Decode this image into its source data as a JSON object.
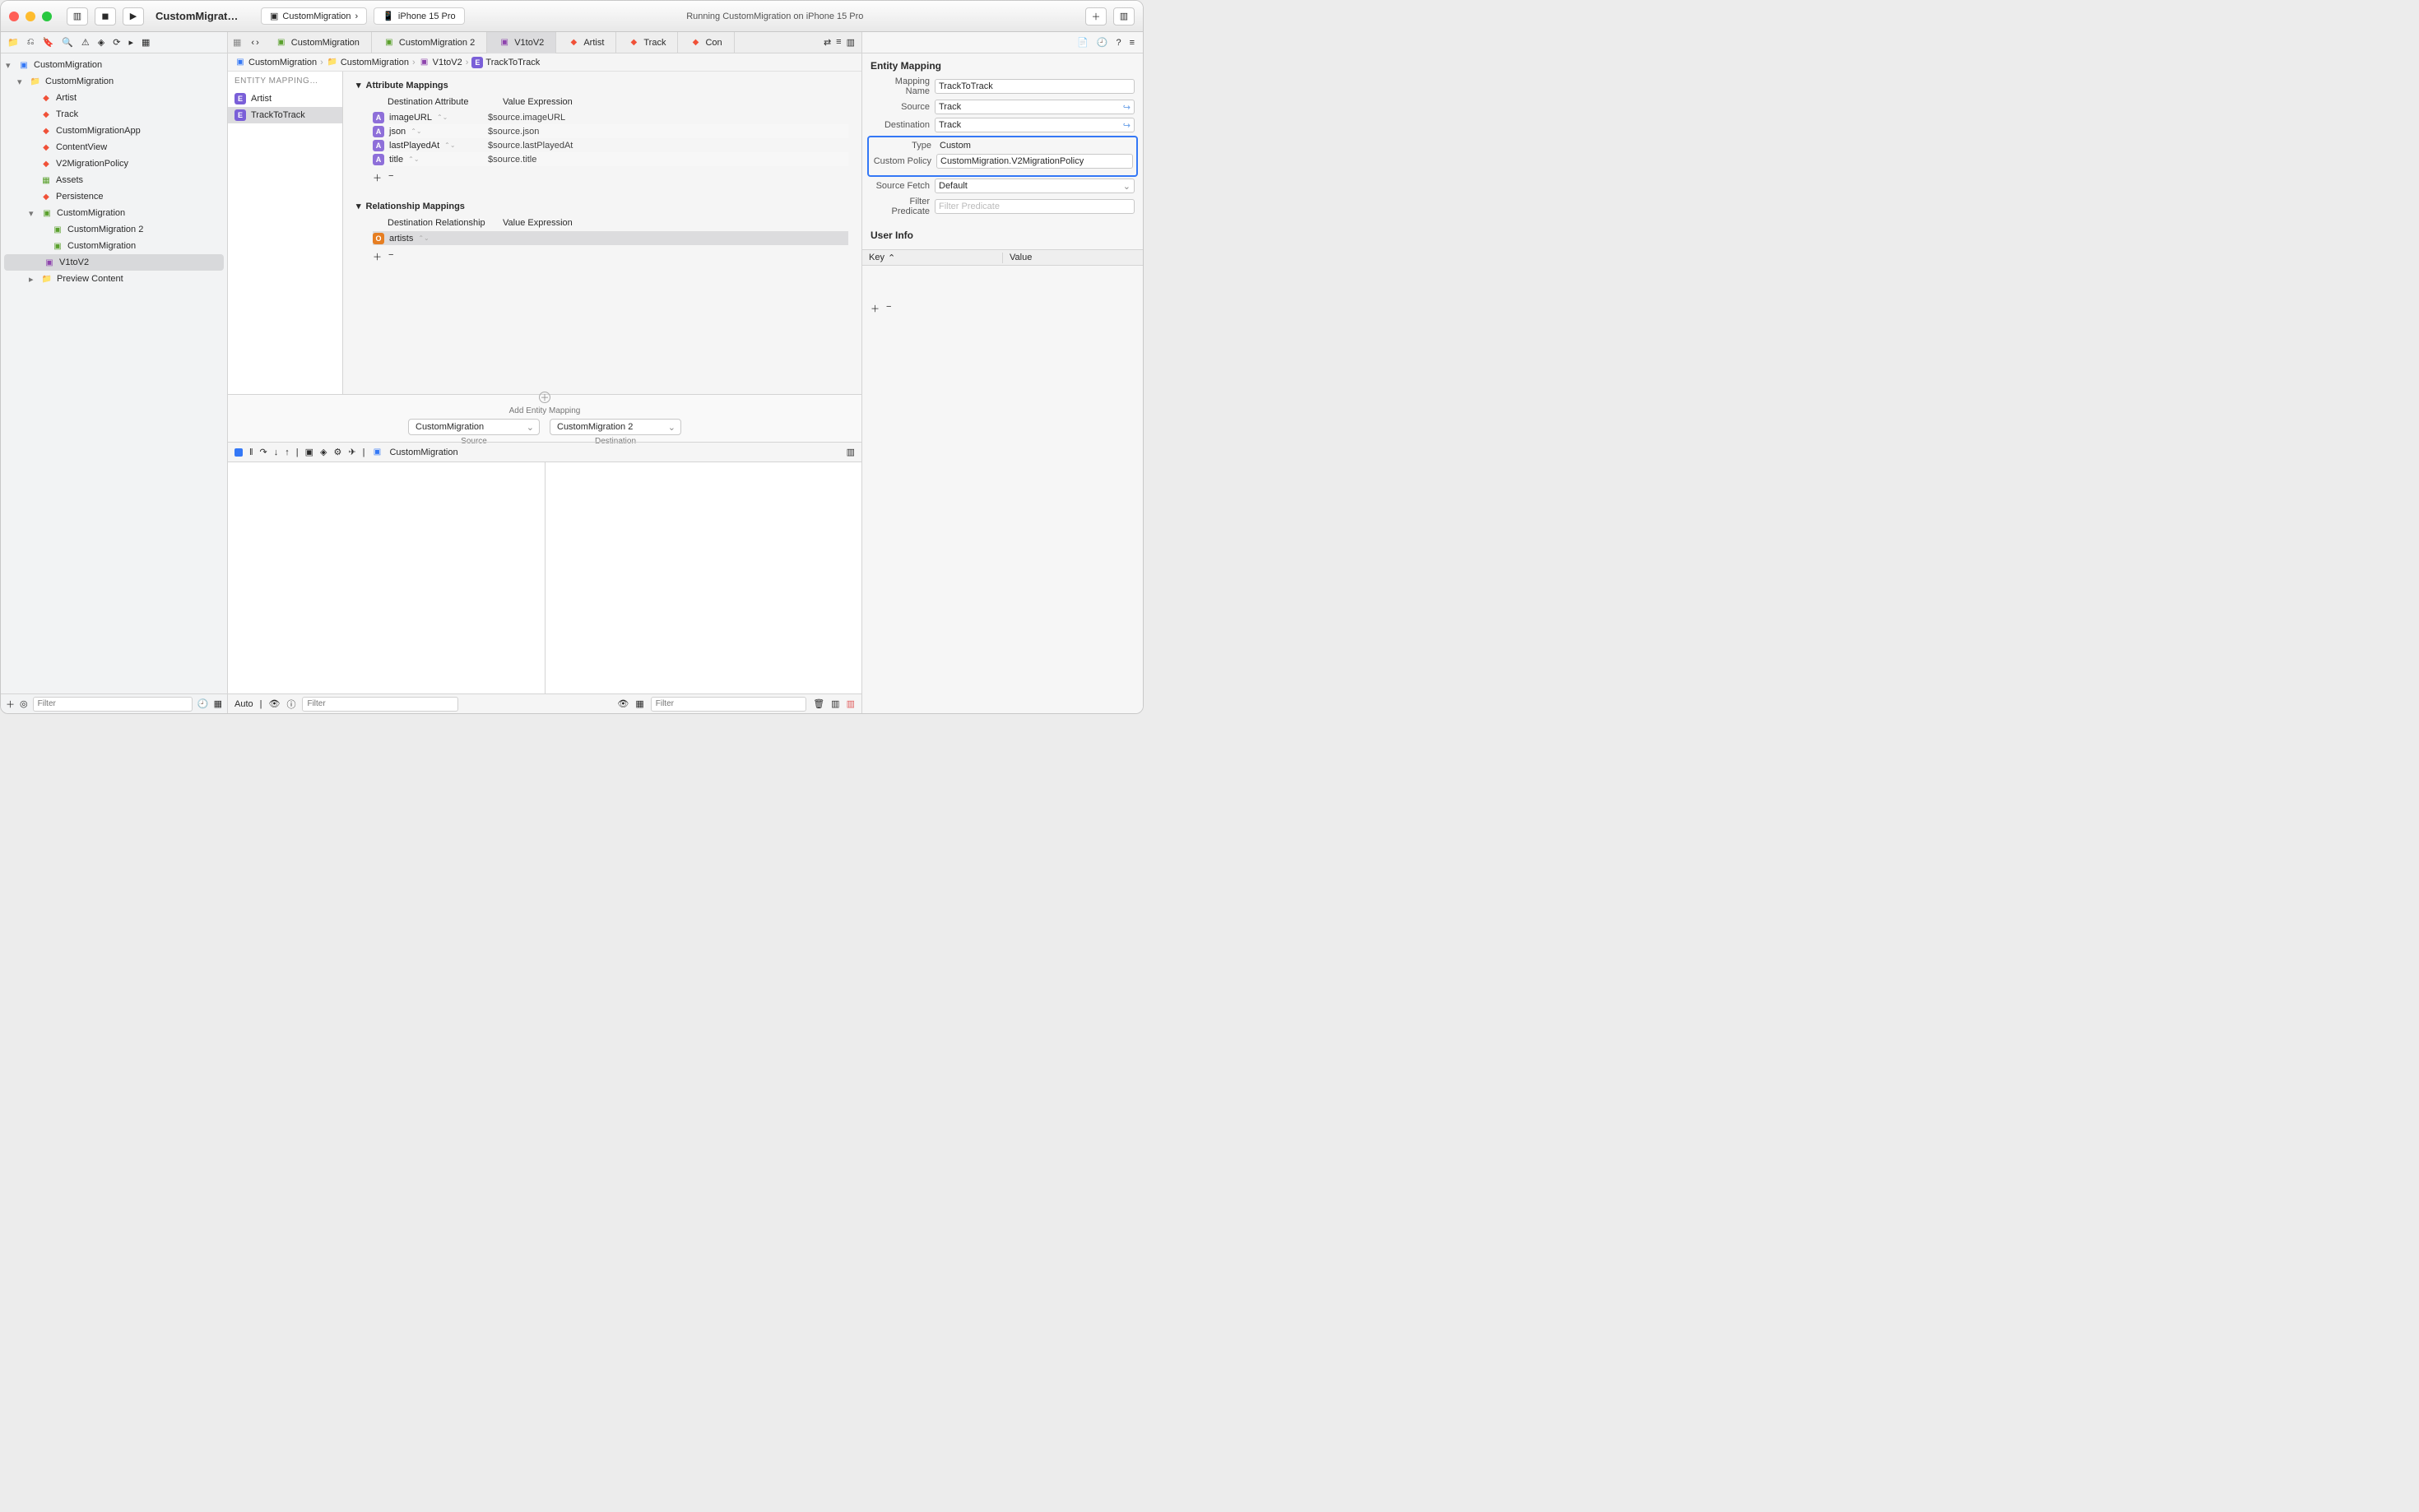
{
  "window": {
    "title": "CustomMigrat…",
    "scheme": "CustomMigration",
    "device": "iPhone 15 Pro",
    "status": "Running CustomMigration on iPhone 15 Pro"
  },
  "navigator": {
    "project": "CustomMigration",
    "groups": [
      {
        "label": "CustomMigration",
        "depth": 0,
        "icon": "app"
      },
      {
        "label": "CustomMigration",
        "depth": 1,
        "icon": "folder"
      },
      {
        "label": "Artist",
        "depth": 2,
        "icon": "swift"
      },
      {
        "label": "Track",
        "depth": 2,
        "icon": "swift"
      },
      {
        "label": "CustomMigrationApp",
        "depth": 2,
        "icon": "swift"
      },
      {
        "label": "ContentView",
        "depth": 2,
        "icon": "swift"
      },
      {
        "label": "V2MigrationPolicy",
        "depth": 2,
        "icon": "swift"
      },
      {
        "label": "Assets",
        "depth": 2,
        "icon": "assets"
      },
      {
        "label": "Persistence",
        "depth": 2,
        "icon": "swift"
      },
      {
        "label": "CustomMigration",
        "depth": 2,
        "icon": "model"
      },
      {
        "label": "CustomMigration 2",
        "depth": 3,
        "icon": "modelversion"
      },
      {
        "label": "CustomMigration",
        "depth": 3,
        "icon": "modelversion"
      },
      {
        "label": "V1toV2",
        "depth": 2,
        "icon": "mapping",
        "selected": true
      },
      {
        "label": "Preview Content",
        "depth": 2,
        "icon": "folder"
      }
    ],
    "filter_placeholder": "Filter"
  },
  "tabs": [
    {
      "label": "CustomMigration",
      "icon": "model"
    },
    {
      "label": "CustomMigration 2",
      "icon": "modelversion"
    },
    {
      "label": "V1toV2",
      "icon": "mapping",
      "active": true
    },
    {
      "label": "Artist",
      "icon": "swift"
    },
    {
      "label": "Track",
      "icon": "swift"
    },
    {
      "label": "Con",
      "icon": "swift"
    }
  ],
  "breadcrumb": [
    "CustomMigration",
    "CustomMigration",
    "V1toV2",
    "TrackToTrack"
  ],
  "entity_list": {
    "header": "ENTITY MAPPING…",
    "items": [
      {
        "label": "Artist"
      },
      {
        "label": "TrackToTrack",
        "selected": true
      }
    ]
  },
  "attribute_mappings": {
    "title": "Attribute Mappings",
    "cols": [
      "Destination Attribute",
      "Value Expression"
    ],
    "rows": [
      {
        "name": "imageURL",
        "expr": "$source.imageURL"
      },
      {
        "name": "json",
        "expr": "$source.json"
      },
      {
        "name": "lastPlayedAt",
        "expr": "$source.lastPlayedAt"
      },
      {
        "name": "title",
        "expr": "$source.title"
      }
    ]
  },
  "relationship_mappings": {
    "title": "Relationship Mappings",
    "cols": [
      "Destination Relationship",
      "Value Expression"
    ],
    "rows": [
      {
        "name": "artists",
        "expr": ""
      }
    ]
  },
  "add_entity_label": "Add Entity Mapping",
  "source_selector": {
    "source": "CustomMigration",
    "dest": "CustomMigration 2",
    "source_label": "Source",
    "dest_label": "Destination"
  },
  "debug": {
    "process": "CustomMigration",
    "auto": "Auto",
    "filter_placeholder": "Filter"
  },
  "inspector": {
    "section_title": "Entity Mapping",
    "mapping_name_label": "Mapping Name",
    "mapping_name": "TrackToTrack",
    "source_label": "Source",
    "source": "Track",
    "dest_label": "Destination",
    "dest": "Track",
    "type_label": "Type",
    "type": "Custom",
    "custom_policy_label": "Custom Policy",
    "custom_policy": "CustomMigration.V2MigrationPolicy",
    "source_fetch_label": "Source Fetch",
    "source_fetch": "Default",
    "filter_predicate_label": "Filter Predicate",
    "filter_predicate_placeholder": "Filter Predicate",
    "user_info_title": "User Info",
    "key_col": "Key",
    "value_col": "Value"
  }
}
